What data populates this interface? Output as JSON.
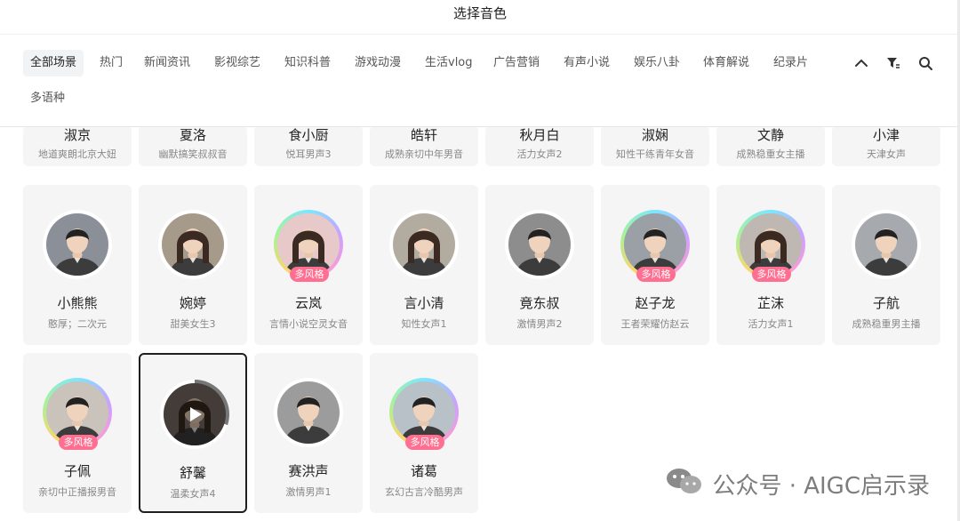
{
  "title": "选择音色",
  "tabs": [
    {
      "label": "全部场景",
      "active": true
    },
    {
      "label": "热门"
    },
    {
      "label": "新闻资讯"
    },
    {
      "label": "影视综艺"
    },
    {
      "label": "知识科普"
    },
    {
      "label": "游戏动漫"
    },
    {
      "label": "生活vlog"
    },
    {
      "label": "广告营销"
    },
    {
      "label": "有声小说"
    },
    {
      "label": "娱乐八卦"
    },
    {
      "label": "体育解说"
    },
    {
      "label": "纪录片"
    }
  ],
  "tabs_row2": [
    "多语种"
  ],
  "toolbar": {
    "icons": [
      "chevron-up-icon",
      "filter-icon",
      "search-icon"
    ]
  },
  "row_top_partial": [
    {
      "name": "淑京",
      "desc": "地道爽朗北京大妞"
    },
    {
      "name": "夏洛",
      "desc": "幽默搞笑叔叔音"
    },
    {
      "name": "食小厨",
      "desc": "悦耳男声3"
    },
    {
      "name": "皓轩",
      "desc": "成熟亲切中年男音"
    },
    {
      "name": "秋月白",
      "desc": "活力女声2"
    },
    {
      "name": "淑娴",
      "desc": "知性干练青年女音"
    },
    {
      "name": "文静",
      "desc": "成熟稳重女主播"
    },
    {
      "name": "小津",
      "desc": "天津女声"
    }
  ],
  "row_middle": [
    {
      "name": "小熊熊",
      "desc": "憨厚；二次元",
      "multi": false,
      "gender": "m",
      "tone": "#8a8f98"
    },
    {
      "name": "婉婷",
      "desc": "甜美女生3",
      "multi": false,
      "gender": "f",
      "tone": "#a69a8b"
    },
    {
      "name": "云岚",
      "desc": "言情小说空灵女音",
      "multi": true,
      "gender": "f",
      "tone": "#e7c9c9"
    },
    {
      "name": "言小清",
      "desc": "知性女声1",
      "multi": false,
      "gender": "f",
      "tone": "#b2ab9f"
    },
    {
      "name": "竟东叔",
      "desc": "激情男声2",
      "multi": false,
      "gender": "m",
      "tone": "#8d8d8d"
    },
    {
      "name": "赵子龙",
      "desc": "王者荣耀仿赵云",
      "multi": true,
      "gender": "m",
      "tone": "#9aa0a6"
    },
    {
      "name": "芷沫",
      "desc": "活力女声1",
      "multi": true,
      "gender": "f",
      "tone": "#bfb8b2"
    },
    {
      "name": "子航",
      "desc": "成熟稳重男主播",
      "multi": false,
      "gender": "m",
      "tone": "#a6aaaf"
    }
  ],
  "row_bottom": [
    {
      "name": "子佩",
      "desc": "亲切中正播报男音",
      "multi": true,
      "gender": "m",
      "tone": "#c9c3bc"
    },
    {
      "name": "舒馨",
      "desc": "温柔女声4",
      "multi": false,
      "gender": "f",
      "tone": "#7a6e66",
      "playing": true,
      "progress": 0.3
    },
    {
      "name": "赛洪声",
      "desc": "激情男声1",
      "multi": false,
      "gender": "m",
      "tone": "#9c9c9c"
    },
    {
      "name": "诸葛",
      "desc": "玄幻古言冷酷男声",
      "multi": true,
      "gender": "m",
      "tone": "#b9c1c8"
    }
  ],
  "badge_label": "多风格",
  "watermark": {
    "text": "公众号 · AIGC启示录",
    "icon": "wechat-icon"
  },
  "colors": {
    "badge": "#ff6f91",
    "card_bg": "#f5f5f5",
    "selected_border": "#1f1f1f"
  }
}
